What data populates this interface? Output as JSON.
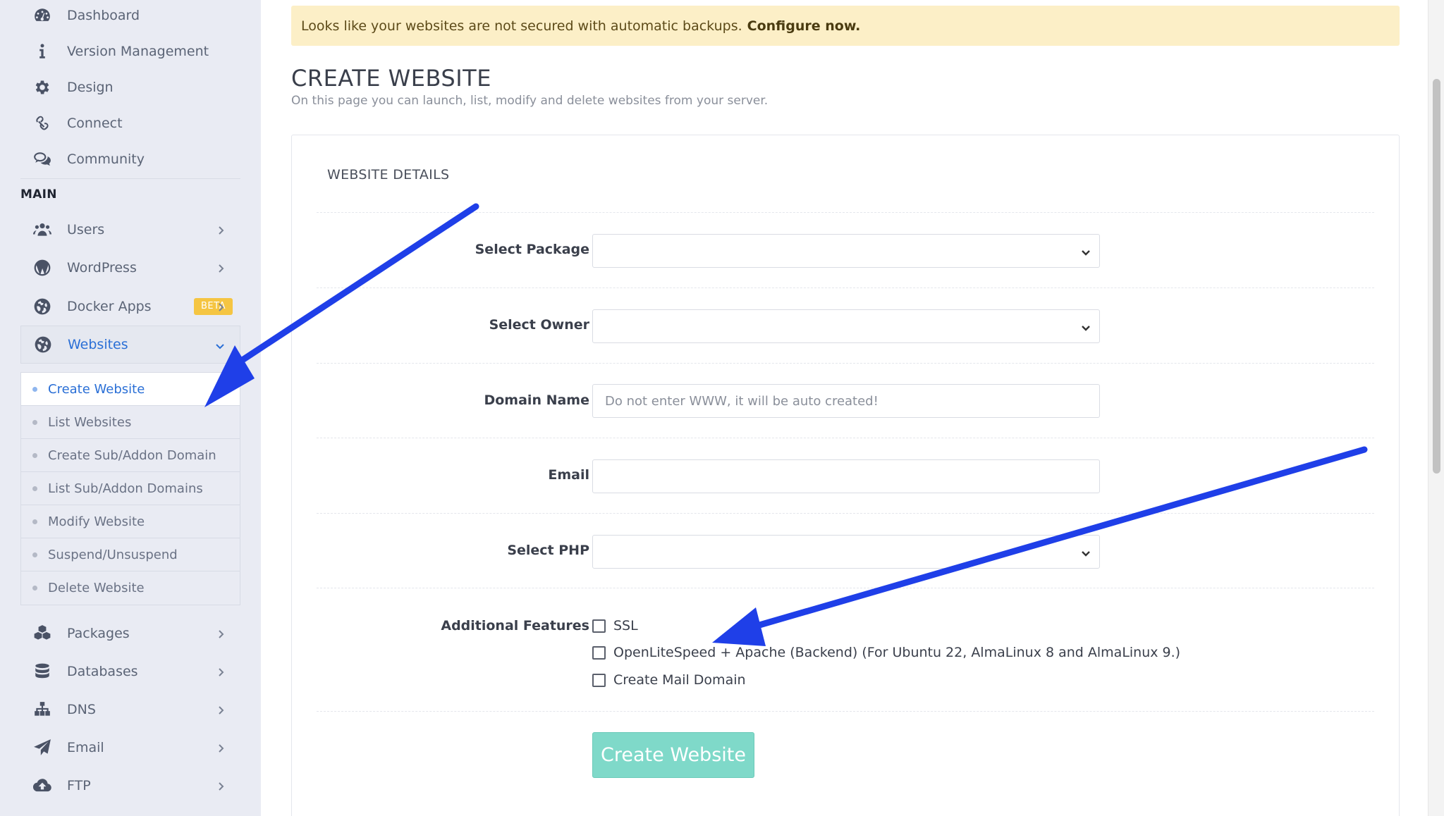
{
  "sidebar": {
    "top_items": [
      {
        "label": "Dashboard",
        "icon": "dashboard-icon"
      },
      {
        "label": "Version Management",
        "icon": "info-icon"
      },
      {
        "label": "Design",
        "icon": "gear-icon"
      },
      {
        "label": "Connect",
        "icon": "link-icon"
      },
      {
        "label": "Community",
        "icon": "chat-icon"
      }
    ],
    "section_label": "MAIN",
    "main_items": [
      {
        "label": "Users",
        "icon": "users-icon"
      },
      {
        "label": "WordPress",
        "icon": "wordpress-icon"
      },
      {
        "label": "Docker Apps",
        "icon": "docker-icon",
        "badge": "BETA"
      },
      {
        "label": "Websites",
        "icon": "globe-icon"
      }
    ],
    "websites_submenu": [
      {
        "label": "Create Website"
      },
      {
        "label": "List Websites"
      },
      {
        "label": "Create Sub/Addon Domain"
      },
      {
        "label": "List Sub/Addon Domains"
      },
      {
        "label": "Modify Website"
      },
      {
        "label": "Suspend/Unsuspend"
      },
      {
        "label": "Delete Website"
      }
    ],
    "bottom_items": [
      {
        "label": "Packages",
        "icon": "cubes-icon"
      },
      {
        "label": "Databases",
        "icon": "database-icon"
      },
      {
        "label": "DNS",
        "icon": "sitemap-icon"
      },
      {
        "label": "Email",
        "icon": "paper-plane-icon"
      },
      {
        "label": "FTP",
        "icon": "cloud-upload-icon"
      }
    ]
  },
  "alert": {
    "text": "Looks like your websites are not secured with automatic backups.",
    "link": "Configure now."
  },
  "page": {
    "title": "CREATE WEBSITE",
    "subtitle": "On this page you can launch, list, modify and delete websites from your server."
  },
  "form": {
    "card_title": "WEBSITE DETAILS",
    "package_label": "Select Package",
    "owner_label": "Select Owner",
    "domain_label": "Domain Name",
    "domain_placeholder": "Do not enter WWW, it will be auto created!",
    "email_label": "Email",
    "php_label": "Select PHP",
    "features_label": "Additional Features",
    "features": [
      {
        "label": "SSL"
      },
      {
        "label": "OpenLiteSpeed + Apache (Backend) (For Ubuntu 22, AlmaLinux 8 and AlmaLinux 9.)"
      },
      {
        "label": "Create Mail Domain"
      }
    ],
    "submit_label": "Create Website"
  },
  "colors": {
    "accent": "#2a6fd6",
    "button": "#7fd9c9",
    "alert_bg": "#fcefc7",
    "annotation_arrow": "#1f3fe8",
    "badge": "#f5c542"
  }
}
